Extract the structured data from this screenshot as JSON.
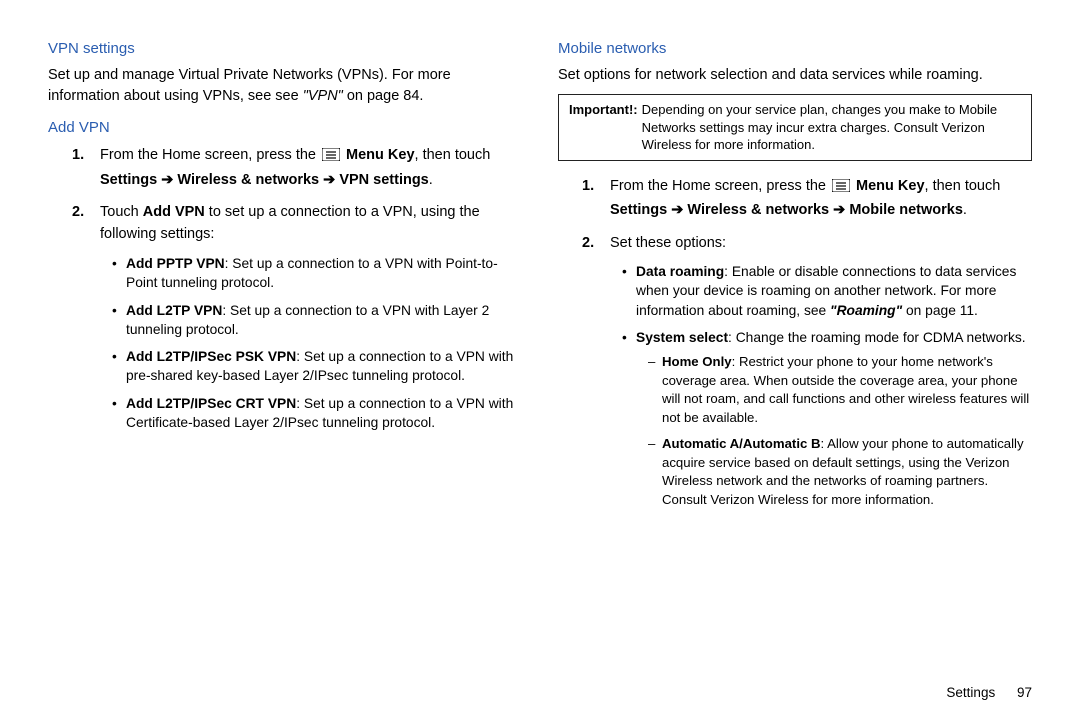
{
  "left": {
    "vpn_heading": "VPN settings",
    "vpn_intro_1": "Set up and manage Virtual Private Networks (VPNs). For more information about using VPNs, see see ",
    "vpn_intro_ref": "\"VPN\"",
    "vpn_intro_2": " on page 84.",
    "add_vpn_heading": "Add VPN",
    "step1_a": "From the Home screen, press the ",
    "step1_menu": " Menu Key",
    "step1_b": ", then touch ",
    "step1_path": "Settings ➔ Wireless & networks ➔ VPN settings",
    "step1_c": ".",
    "step2_a": "Touch ",
    "step2_addvpn": "Add VPN",
    "step2_b": " to set up a connection to a VPN, using the following settings:",
    "b1_t": "Add PPTP VPN",
    "b1_d": ": Set up a connection to a VPN with Point-to-Point tunneling protocol.",
    "b2_t": "Add L2TP VPN",
    "b2_d": ": Set up a connection to a VPN with Layer 2 tunneling protocol.",
    "b3_t": "Add L2TP/IPSec PSK VPN",
    "b3_d": ": Set up a connection to a VPN with pre-shared key-based Layer 2/IPsec tunneling protocol.",
    "b4_t": "Add L2TP/IPSec CRT VPN",
    "b4_d": ": Set up a connection to a VPN with Certificate-based Layer 2/IPsec tunneling protocol."
  },
  "right": {
    "mobile_heading": "Mobile networks",
    "mobile_intro": "Set options for network selection and data services while roaming.",
    "important_label": "Important!:",
    "important_text": " Depending on your service plan, changes you make to Mobile Networks settings may incur extra charges. Consult Verizon Wireless for more information.",
    "step1_a": "From the Home screen, press the ",
    "step1_menu": " Menu Key",
    "step1_b": ", then touch ",
    "step1_path": "Settings ➔ Wireless & networks ➔ Mobile networks",
    "step1_c": ".",
    "step2": "Set these options:",
    "b1_t": "Data roaming",
    "b1_d1": ": Enable or disable connections to data services when your device is roaming on another network. For more information about roaming, see ",
    "b1_ref": "\"Roaming\"",
    "b1_d2": " on page 11.",
    "b2_t": "System select",
    "b2_d": ": Change the roaming mode for CDMA networks.",
    "d1_t": "Home Only",
    "d1_d": ": Restrict your phone to your home network's coverage area. When outside the coverage area, your phone will not roam, and call functions and other wireless features will not be available.",
    "d2_t": "Automatic A/Automatic B",
    "d2_d": ": Allow your phone to automatically acquire service based on default settings, using the Verizon Wireless network and the networks of roaming partners. Consult Verizon Wireless for more information."
  },
  "footer": {
    "section": "Settings",
    "page": "97"
  },
  "nums": {
    "n1": "1.",
    "n2": "2."
  }
}
